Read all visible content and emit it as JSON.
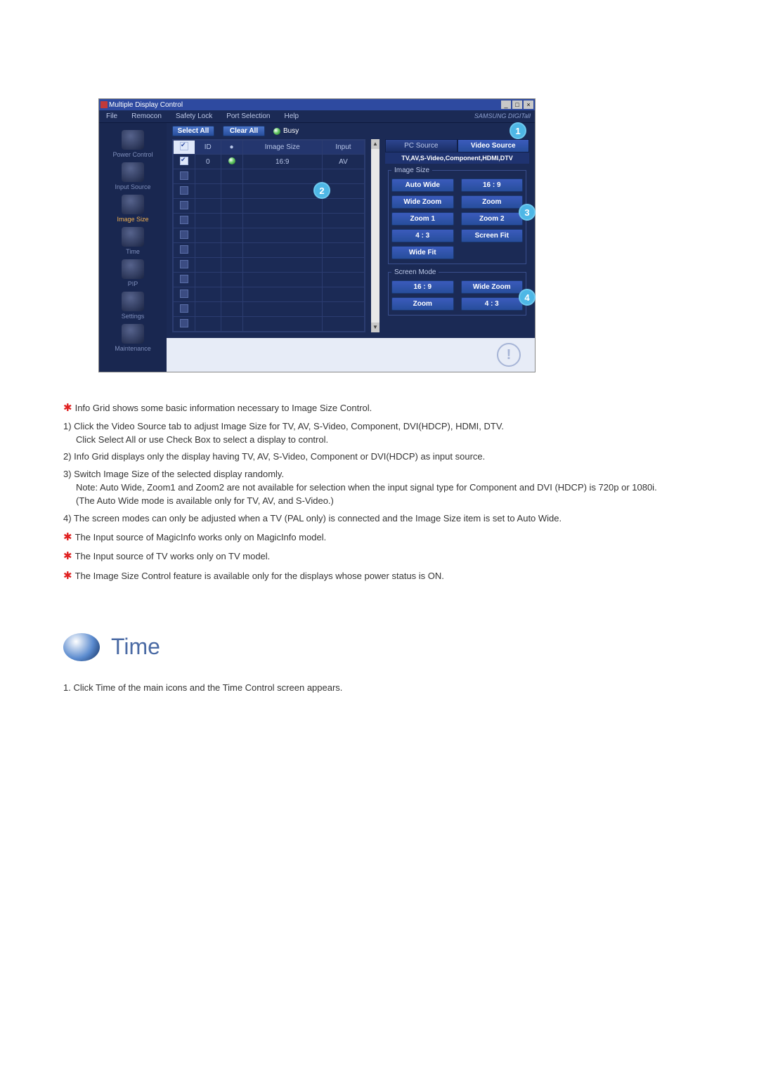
{
  "window": {
    "title": "Multiple Display Control",
    "menus": [
      "File",
      "Remocon",
      "Safety Lock",
      "Port Selection",
      "Help"
    ],
    "brand": "SAMSUNG DIGITall"
  },
  "sidebar": {
    "items": [
      {
        "label": "Power Control"
      },
      {
        "label": "Input Source"
      },
      {
        "label": "Image Size"
      },
      {
        "label": "Time"
      },
      {
        "label": "PIP"
      },
      {
        "label": "Settings"
      },
      {
        "label": "Maintenance"
      }
    ],
    "active_index": 2
  },
  "toolbar": {
    "select_all": "Select All",
    "clear_all": "Clear All",
    "busy": "Busy"
  },
  "grid": {
    "headers": {
      "id": "ID",
      "image_size": "Image Size",
      "input": "Input"
    },
    "rows": [
      {
        "checked": true,
        "id": "0",
        "status": "green",
        "image_size": "16:9",
        "input": "AV"
      },
      {
        "checked": false
      },
      {
        "checked": false
      },
      {
        "checked": false
      },
      {
        "checked": false
      },
      {
        "checked": false
      },
      {
        "checked": false
      },
      {
        "checked": false
      },
      {
        "checked": false
      },
      {
        "checked": false
      },
      {
        "checked": false
      },
      {
        "checked": false
      }
    ]
  },
  "source_tabs": {
    "pc": "PC Source",
    "video": "Video Source",
    "active": "video"
  },
  "info_line": "TV,AV,S-Video,Component,HDMI,DTV",
  "image_size_group": {
    "legend": "Image Size",
    "buttons": [
      "Auto Wide",
      "16 : 9",
      "Wide Zoom",
      "Zoom",
      "Zoom 1",
      "Zoom 2",
      "4 : 3",
      "Screen Fit",
      "Wide Fit"
    ]
  },
  "screen_mode_group": {
    "legend": "Screen Mode",
    "buttons": [
      "16 : 9",
      "Wide Zoom",
      "Zoom",
      "4 : 3"
    ]
  },
  "callouts": {
    "c1": "1",
    "c2": "2",
    "c3": "3",
    "c4": "4"
  },
  "doc": {
    "s1": "Info Grid shows some basic information necessary to Image Size Control.",
    "n1_a": "1)  Click the Video Source tab to adjust Image Size for TV, AV, S-Video, Component, DVI(HDCP), HDMI, DTV.",
    "n1_b": "Click Select All or use Check Box to select a display to control.",
    "n2": "2)  Info Grid displays only the display having TV, AV, S-Video, Component or DVI(HDCP) as input source.",
    "n3_a": "3)  Switch Image Size of the selected display randomly.",
    "n3_b": "Note: Auto Wide, Zoom1 and Zoom2 are not available for selection when the input signal type for Component and DVI (HDCP) is 720p or 1080i.",
    "n3_c": "(The Auto Wide mode is available only for TV, AV, and S-Video.)",
    "n4": "4)  The screen modes can only be adjusted when a TV (PAL only) is connected and the Image Size item is set to Auto Wide.",
    "s2": "The Input source of MagicInfo works only on MagicInfo model.",
    "s3": "The Input source of TV works only on TV model.",
    "s4": "The Image Size Control feature is available only for the displays whose power status is ON."
  },
  "time": {
    "title": "Time",
    "line1": "1.  Click Time of the main icons and the Time Control screen appears."
  }
}
